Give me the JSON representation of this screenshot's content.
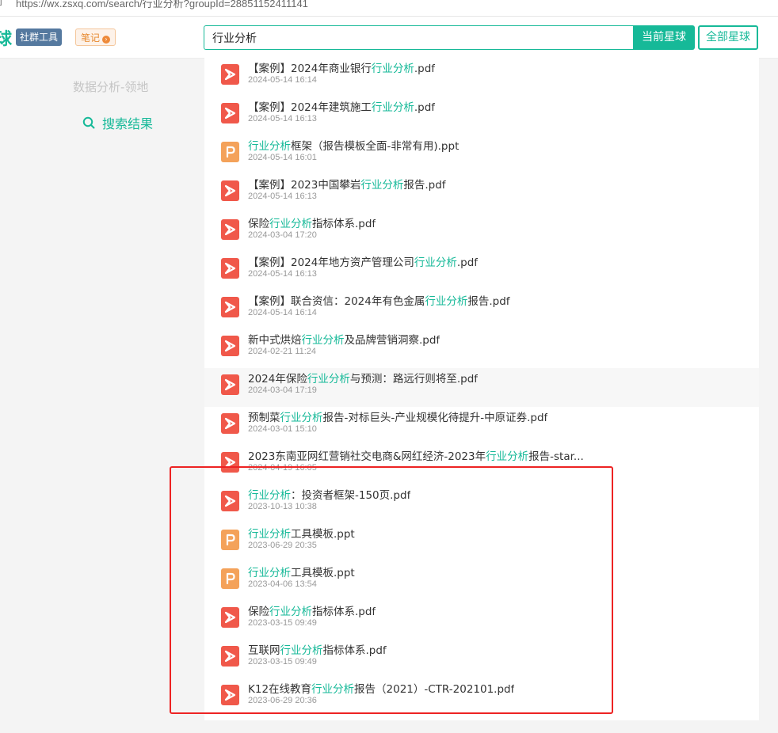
{
  "browser": {
    "url": "https://wx.zsxq.com/search/行业分析?groupId=28851152411141",
    "edge_char": "]"
  },
  "header": {
    "logo_char": "球",
    "tool_tag": "社群工具",
    "notes_tag": "笔记",
    "notes_dot": "›",
    "search_value": "行业分析",
    "btn_current": "当前星球",
    "btn_all": "全部星球"
  },
  "sidebar": {
    "group_name": "数据分析-领地",
    "item_label": "搜索结果"
  },
  "keyword": "行业分析",
  "colors": {
    "accent": "#16b998",
    "pdf": "#f0584a",
    "ppt": "#f4a25a",
    "annotation": "#ed2323"
  },
  "results": [
    {
      "type": "pdf",
      "pre": "【案例】2024年商业银行",
      "hl": "行业分析",
      "post": ".pdf",
      "date": "2024-05-14 16:14"
    },
    {
      "type": "pdf",
      "pre": "【案例】2024年建筑施工",
      "hl": "行业分析",
      "post": ".pdf",
      "date": "2024-05-14 16:13"
    },
    {
      "type": "ppt",
      "pre": "",
      "hl": "行业分析",
      "post": "框架（报告模板全面-非常有用).ppt",
      "date": "2024-05-14 16:01"
    },
    {
      "type": "pdf",
      "pre": "【案例】2023中国攀岩",
      "hl": "行业分析",
      "post": "报告.pdf",
      "date": "2024-05-14 16:13"
    },
    {
      "type": "pdf",
      "pre": "保险",
      "hl": "行业分析",
      "post": "指标体系.pdf",
      "date": "2024-03-04 17:20"
    },
    {
      "type": "pdf",
      "pre": "【案例】2024年地方资产管理公司",
      "hl": "行业分析",
      "post": ".pdf",
      "date": "2024-05-14 16:13"
    },
    {
      "type": "pdf",
      "pre": "【案例】联合资信：2024年有色金属",
      "hl": "行业分析",
      "post": "报告.pdf",
      "date": "2024-05-14 16:14"
    },
    {
      "type": "pdf",
      "pre": "新中式烘焙",
      "hl": "行业分析",
      "post": "及品牌营销洞察.pdf",
      "date": "2024-02-21 11:24"
    },
    {
      "type": "pdf",
      "pre": "2024年保险",
      "hl": "行业分析",
      "post": "与预测：路远行则将至.pdf",
      "date": "2024-03-04 17:19",
      "hover": true
    },
    {
      "type": "pdf",
      "pre": "预制菜",
      "hl": "行业分析",
      "post": "报告-对标巨头-产业规模化待提升-中原证券.pdf",
      "date": "2024-03-01 15:10"
    },
    {
      "type": "pdf",
      "pre": "2023东南亚网红营销社交电商&网红经济-2023年",
      "hl": "行业分析",
      "post": "报告-star...",
      "date": "2024-04-19 16:05"
    },
    {
      "type": "pdf",
      "pre": "",
      "hl": "行业分析",
      "post": "：投资者框架-150页.pdf",
      "date": "2023-10-13 10:38"
    },
    {
      "type": "ppt",
      "pre": "",
      "hl": "行业分析",
      "post": "工具模板.ppt",
      "date": "2023-06-29 20:35"
    },
    {
      "type": "ppt",
      "pre": "",
      "hl": "行业分析",
      "post": "工具模板.ppt",
      "date": "2023-04-06 13:54"
    },
    {
      "type": "pdf",
      "pre": "保险",
      "hl": "行业分析",
      "post": "指标体系.pdf",
      "date": "2023-03-15 09:49"
    },
    {
      "type": "pdf",
      "pre": "互联网",
      "hl": "行业分析",
      "post": "指标体系.pdf",
      "date": "2023-03-15 09:49"
    },
    {
      "type": "pdf",
      "pre": "K12在线教育",
      "hl": "行业分析",
      "post": "报告（2021）-CTR-202101.pdf",
      "date": "2023-06-29 20:36"
    }
  ]
}
